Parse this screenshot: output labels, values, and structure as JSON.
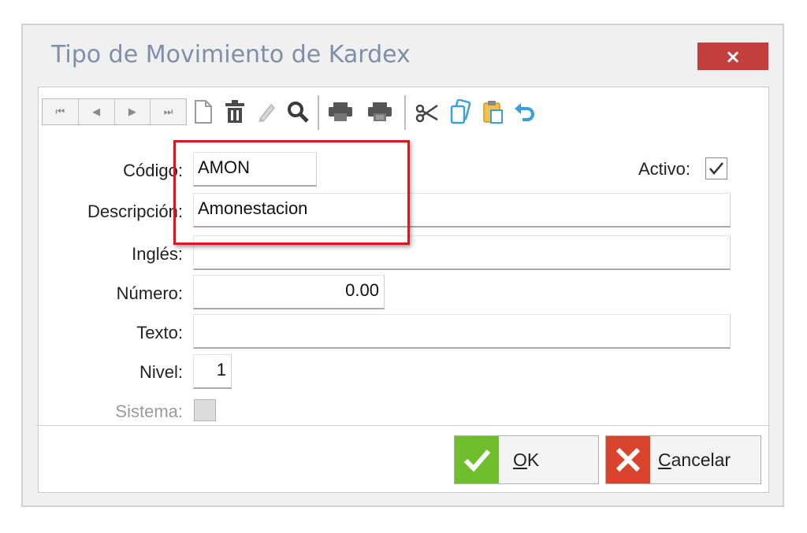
{
  "window": {
    "title": "Tipo de Movimiento de Kardex",
    "close_glyph": "×"
  },
  "toolbar": {
    "nav": [
      "⏮",
      "◀",
      "▶",
      "⏭"
    ],
    "icons": [
      "new-document-icon",
      "delete-icon",
      "edit-icon",
      "search-icon",
      "print-icon",
      "print-preview-icon",
      "cut-icon",
      "copy-icon",
      "paste-icon",
      "undo-icon"
    ]
  },
  "form": {
    "codigo_label": "Código:",
    "codigo_value": "AMON",
    "activo_label": "Activo:",
    "activo_checked": true,
    "descripcion_label": "Descripción:",
    "descripcion_value": "Amonestacion",
    "ingles_label": "Inglés:",
    "ingles_value": "",
    "numero_label": "Número:",
    "numero_value": "0.00",
    "texto_label": "Texto:",
    "texto_value": "",
    "nivel_label": "Nivel:",
    "nivel_value": "1",
    "sistema_label": "Sistema:",
    "sistema_checked": false
  },
  "buttons": {
    "ok_mnemonic": "O",
    "ok_rest": "K",
    "cancel_mnemonic": "C",
    "cancel_rest": "ancelar"
  },
  "colors": {
    "close_bg": "#c1403d",
    "ok_icon_bg": "#6fbe2c",
    "cancel_icon_bg": "#d9452c",
    "highlight": "#e0141b",
    "title_text": "#7f8fa8",
    "icon_blue": "#3aa0dc"
  }
}
